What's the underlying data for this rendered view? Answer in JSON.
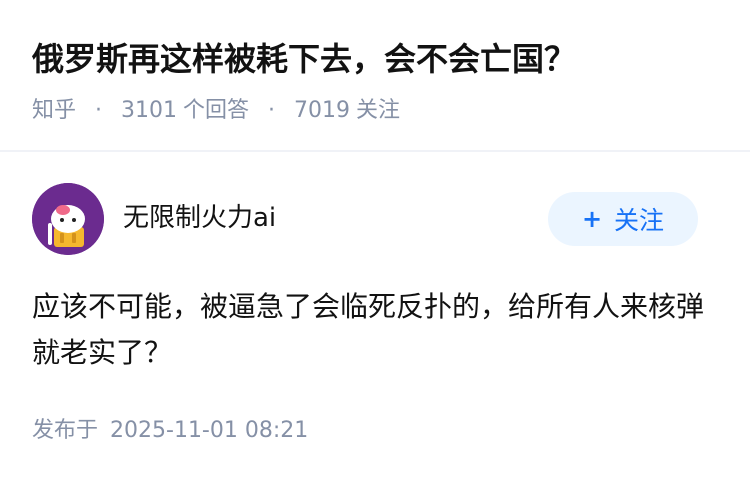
{
  "question": {
    "title": "俄罗斯再这样被耗下去，会不会亡国？",
    "source": "知乎",
    "separator": "·",
    "answers_count": "3101",
    "answers_label": "个回答",
    "followers_count": "7019",
    "followers_label": "关注"
  },
  "answer": {
    "author_name": "无限制火力ai",
    "follow_icon": "plus-icon",
    "follow_symbol": "+",
    "follow_label": "关注",
    "content": "应该不可能，被逼急了会临死反扑的，给所有人来核弹就老实了？",
    "published_label": "发布于",
    "published_time": "2025-11-01 08:21"
  },
  "colors": {
    "text_primary": "#121212",
    "text_secondary": "#8590a6",
    "accent": "#1772f6",
    "follow_bg": "#ebf5ff",
    "avatar_bg": "#6b2b8f",
    "divider": "#f0f2f7"
  }
}
